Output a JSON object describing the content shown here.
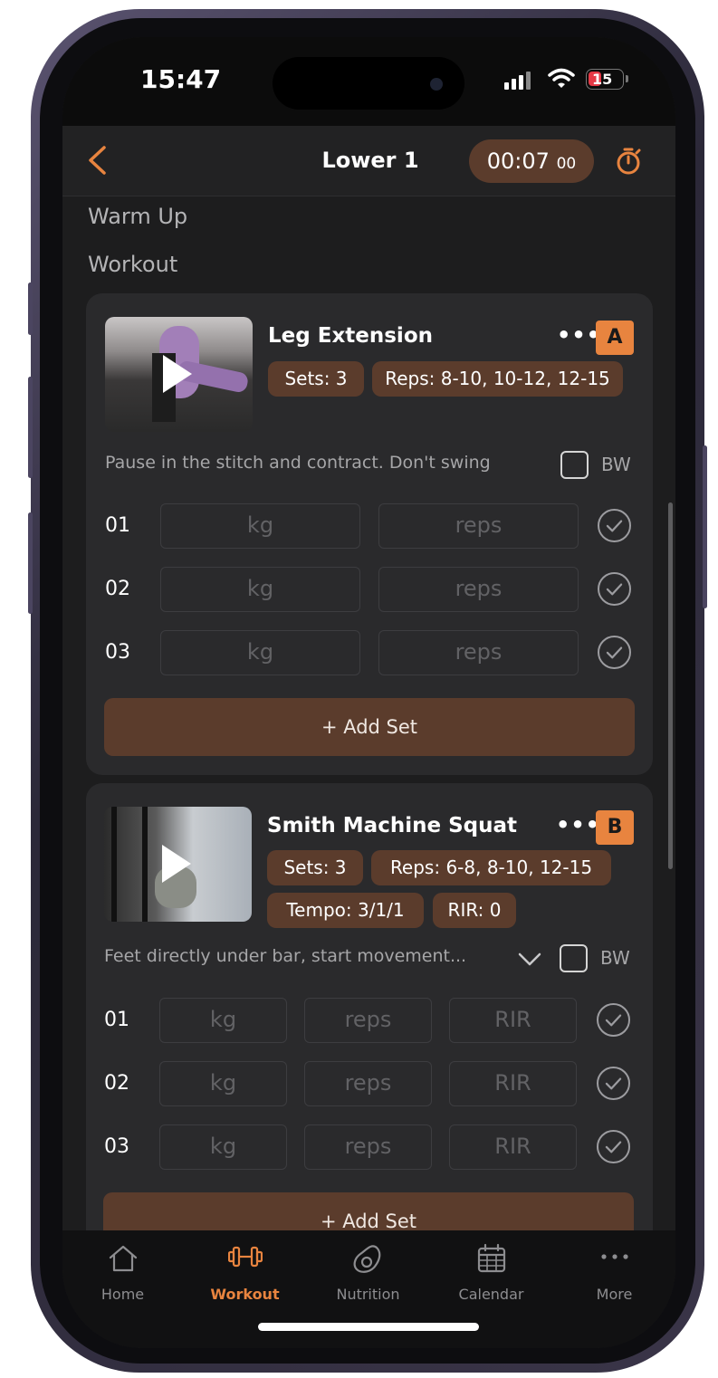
{
  "status": {
    "time": "15:47",
    "battery": "15"
  },
  "nav": {
    "title": "Lower 1",
    "timer_main": "00:07",
    "timer_sub": "00"
  },
  "sections": {
    "warmup": "Warm Up",
    "workout": "Workout"
  },
  "exercise_a": {
    "title": "Leg Extension",
    "letter": "A",
    "chips": [
      "Sets: 3",
      "Reps: 8-10, 10-12, 12-15"
    ],
    "note": "Pause in the stitch and contract. Don't swing",
    "bw": "BW",
    "sets": [
      {
        "num": "01",
        "kg": "kg",
        "reps": "reps"
      },
      {
        "num": "02",
        "kg": "kg",
        "reps": "reps"
      },
      {
        "num": "03",
        "kg": "kg",
        "reps": "reps"
      }
    ],
    "add_set": "+ Add Set"
  },
  "exercise_b": {
    "title": "Smith Machine Squat",
    "letter": "B",
    "chips": [
      "Sets: 3",
      "Reps: 6-8, 8-10, 12-15",
      "Tempo: 3/1/1",
      "RIR: 0"
    ],
    "note": "Feet directly under bar, start movement...",
    "bw": "BW",
    "sets": [
      {
        "num": "01",
        "kg": "kg",
        "reps": "reps",
        "rir": "RIR"
      },
      {
        "num": "02",
        "kg": "kg",
        "reps": "reps",
        "rir": "RIR"
      },
      {
        "num": "03",
        "kg": "kg",
        "reps": "reps",
        "rir": "RIR"
      }
    ],
    "add_set": "+ Add Set"
  },
  "tabs": [
    {
      "label": "Home",
      "icon": "home-icon"
    },
    {
      "label": "Workout",
      "icon": "dumbbell-icon"
    },
    {
      "label": "Nutrition",
      "icon": "avocado-icon"
    },
    {
      "label": "Calendar",
      "icon": "calendar-icon"
    },
    {
      "label": "More",
      "icon": "more-icon"
    }
  ],
  "colors": {
    "accent": "#e8843f",
    "chip": "#5b3c2c",
    "card": "#2a2a2c",
    "background": "#1d1d1e"
  }
}
